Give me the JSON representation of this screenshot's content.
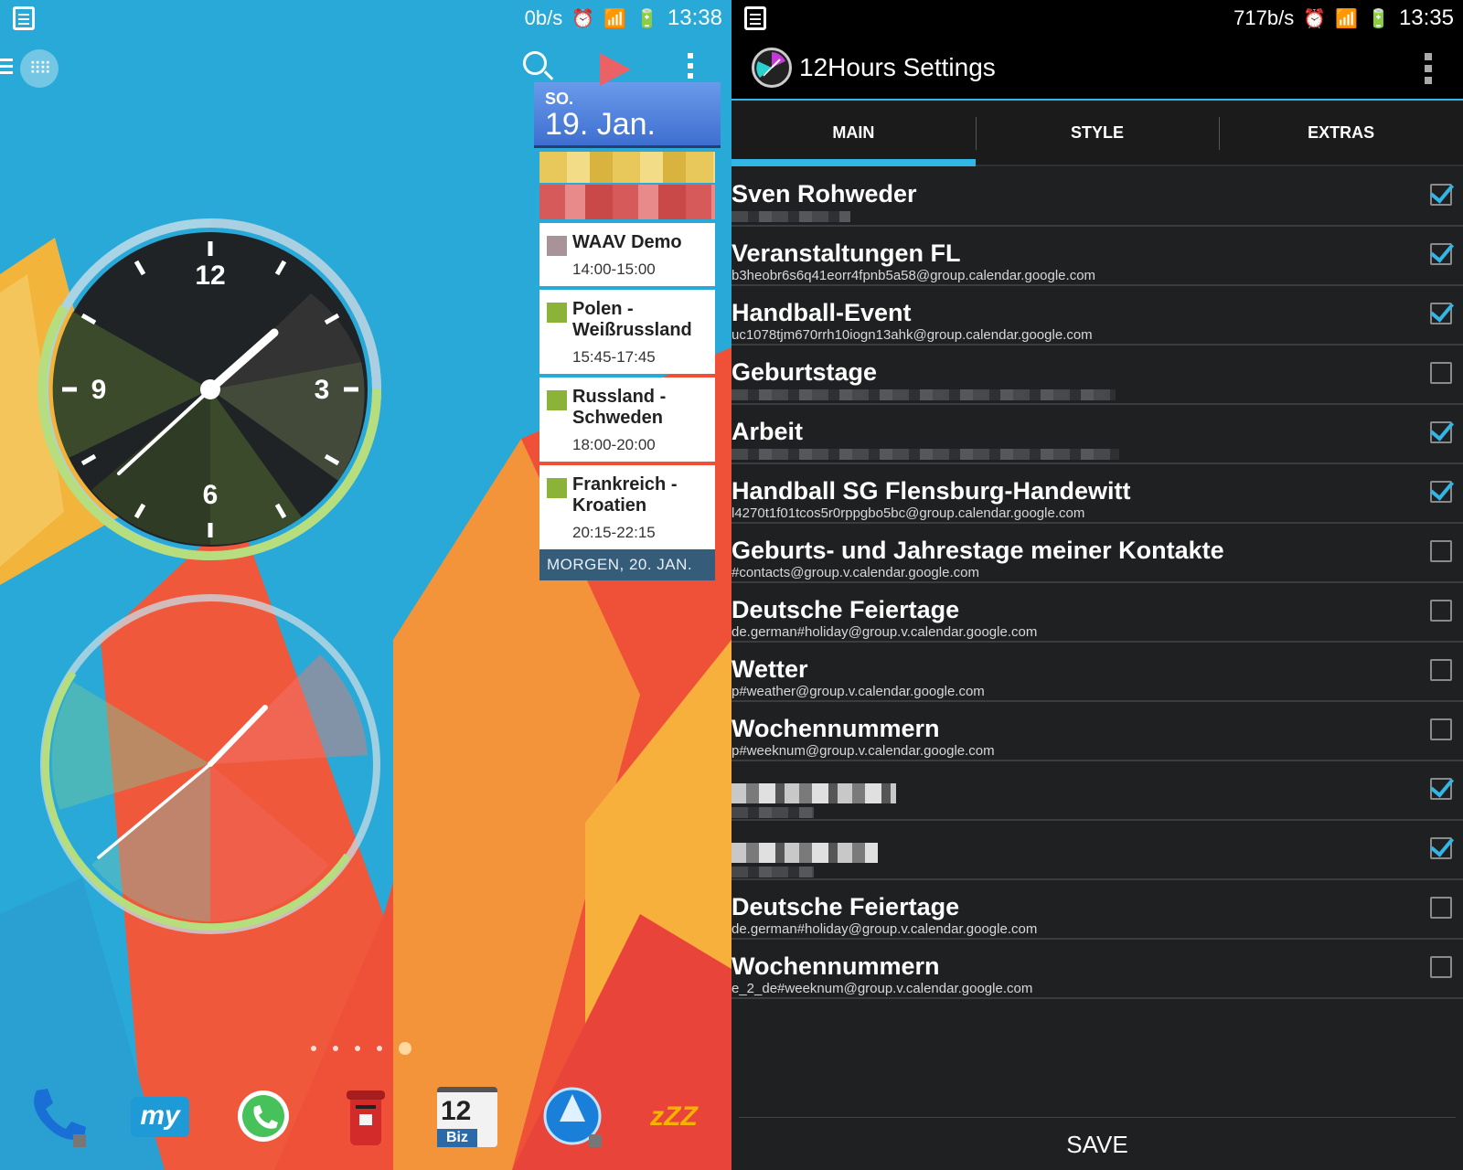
{
  "left": {
    "status": {
      "net_speed": "0b/s",
      "time": "13:38"
    },
    "calendar": {
      "day_of_week": "SO.",
      "date": "19. Jan.",
      "events": [
        {
          "title": "WAAV Demo",
          "time": "14:00-15:00",
          "color": "#a89498"
        },
        {
          "title": "Polen - Weißrussland",
          "time": "15:45-17:45",
          "color": "#8bb33a"
        },
        {
          "title": "Russland - Schweden",
          "time": "18:00-20:00",
          "color": "#8bb33a"
        },
        {
          "title": "Frankreich - Kroatien",
          "time": "20:15-22:15",
          "color": "#8bb33a"
        }
      ],
      "next_day": "MORGEN, 20. JAN."
    },
    "clock1": {
      "labels": {
        "12": "12",
        "3": "3",
        "6": "6",
        "9": "9"
      }
    },
    "dock": [
      {
        "name": "phone-app",
        "icon": "phone-icon"
      },
      {
        "name": "my-app",
        "icon": "my-icon",
        "label": "my"
      },
      {
        "name": "whatsapp-app",
        "icon": "whatsapp-icon"
      },
      {
        "name": "mailbox-app",
        "icon": "mailbox-icon"
      },
      {
        "name": "calendar-12-biz-app",
        "icon": "calendar-icon",
        "label": "12",
        "sublabel": "Biz"
      },
      {
        "name": "boat-browser-app",
        "icon": "globe-icon"
      },
      {
        "name": "sleep-app",
        "icon": "sleep-icon",
        "label": "zZZ"
      }
    ]
  },
  "right": {
    "status": {
      "net_speed": "717b/s",
      "time": "13:35"
    },
    "title": "12Hours Settings",
    "tabs": [
      "MAIN",
      "STYLE",
      "EXTRAS"
    ],
    "active_tab": "MAIN",
    "accent": "#33b5e5",
    "calendars": [
      {
        "title": "Sven Rohweder",
        "subtitle": "",
        "checked": true
      },
      {
        "title": "Veranstaltungen FL",
        "subtitle": "b3heobr6s6q41eorr4fpnb5a58@group.calendar.google.com",
        "checked": true
      },
      {
        "title": "Handball-Event",
        "subtitle": "uc1078tjm670rrh10iogn13ahk@group.calendar.google.com",
        "checked": true
      },
      {
        "title": "Geburtstage",
        "subtitle": "",
        "checked": false
      },
      {
        "title": "Arbeit",
        "subtitle": "",
        "checked": true
      },
      {
        "title": "Handball SG Flensburg-Handewitt",
        "subtitle": "l4270t1f01tcos5r0rppgbo5bc@group.calendar.google.com",
        "checked": true
      },
      {
        "title": "Geburts- und Jahrestage meiner Kontakte",
        "subtitle": "#contacts@group.v.calendar.google.com",
        "checked": false
      },
      {
        "title": "Deutsche Feiertage",
        "subtitle": "de.german#holiday@group.v.calendar.google.com",
        "checked": false
      },
      {
        "title": "Wetter",
        "subtitle": "p#weather@group.v.calendar.google.com",
        "checked": false
      },
      {
        "title": "Wochennummern",
        "subtitle": "p#weeknum@group.v.calendar.google.com",
        "checked": false
      },
      {
        "title": "",
        "subtitle": "",
        "checked": true
      },
      {
        "title": "",
        "subtitle": "",
        "checked": true
      },
      {
        "title": "Deutsche Feiertage",
        "subtitle": "de.german#holiday@group.v.calendar.google.com",
        "checked": false
      },
      {
        "title": "Wochennummern",
        "subtitle": "e_2_de#weeknum@group.v.calendar.google.com",
        "checked": false
      }
    ],
    "save_label": "SAVE"
  }
}
